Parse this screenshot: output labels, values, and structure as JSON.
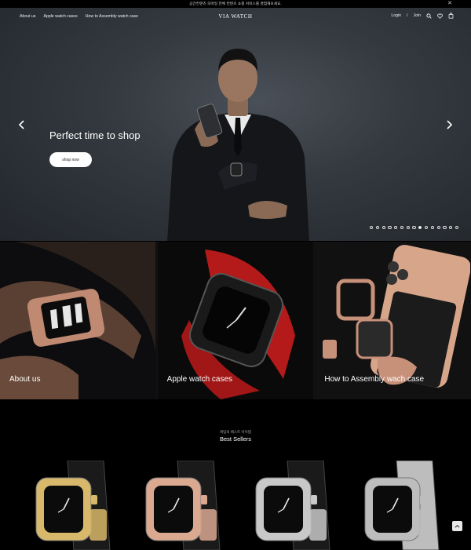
{
  "announcement": {
    "text": "공간컨텐츠 모바일 전체 컨텐츠 쇼핑 서비스를 경험해보세요.",
    "close": "✕"
  },
  "nav": {
    "links": [
      "About us",
      "Apple watch cases",
      "How to Assembly watch case"
    ],
    "logo": "VIA WATCH",
    "login": "Login",
    "separator": "/",
    "join": "Join"
  },
  "hero": {
    "title": "Perfect time to shop",
    "button": "shop now",
    "slides_total": 15,
    "active_slide": 9
  },
  "categories": [
    {
      "label": "About us"
    },
    {
      "label": "Apple watch cases"
    },
    {
      "label": "How to Assembly wach case"
    }
  ],
  "best_sellers": {
    "subtitle": "여답의 베스트 아이템",
    "title": "Best Sellers",
    "products": [
      {
        "finish": "gold",
        "color": "#d8b86a"
      },
      {
        "finish": "rose-gold",
        "color": "#dba890"
      },
      {
        "finish": "silver",
        "color": "#c8c8c8"
      },
      {
        "finish": "silver-link",
        "color": "#bdbdbd"
      }
    ]
  },
  "colors": {
    "background": "#000000",
    "hero_bg": "#353a40",
    "accent": "#ffffff"
  }
}
